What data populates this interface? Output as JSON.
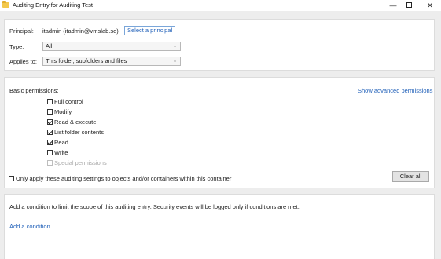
{
  "window": {
    "title": "Auditing Entry for Auditing Test",
    "minimize": "—",
    "close": "✕"
  },
  "principal": {
    "label": "Principal:",
    "value": "itadmin (itadmin@vmslab.se)",
    "select_link": "Select a principal"
  },
  "type": {
    "label": "Type:",
    "value": "All"
  },
  "applies_to": {
    "label": "Applies to:",
    "value": "This folder, subfolders and files"
  },
  "basic_permissions": {
    "label": "Basic permissions:",
    "show_advanced": "Show advanced permissions",
    "items": [
      {
        "label": "Full control",
        "checked": false,
        "disabled": false
      },
      {
        "label": "Modify",
        "checked": false,
        "disabled": false
      },
      {
        "label": "Read & execute",
        "checked": true,
        "disabled": false
      },
      {
        "label": "List folder contents",
        "checked": true,
        "disabled": false
      },
      {
        "label": "Read",
        "checked": true,
        "disabled": false
      },
      {
        "label": "Write",
        "checked": false,
        "disabled": false
      },
      {
        "label": "Special permissions",
        "checked": false,
        "disabled": true
      }
    ],
    "only_apply": "Only apply these auditing settings to objects and/or containers within this container",
    "only_apply_checked": false,
    "clear_all": "Clear all"
  },
  "condition": {
    "description": "Add a condition to limit the scope of this auditing entry. Security events will be logged only if conditions are met.",
    "add_link": "Add a condition"
  }
}
